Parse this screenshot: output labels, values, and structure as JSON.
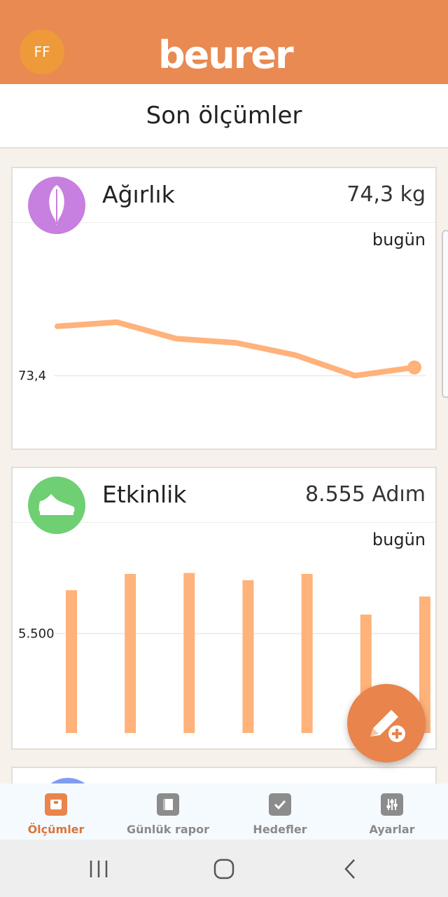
{
  "header": {
    "avatar_initials": "FF",
    "brand": "beurer",
    "brand_color": "#e88a52"
  },
  "page_title": "Son ölçümler",
  "weight_card": {
    "title": "Ağırlık",
    "value": "74,3 kg",
    "period": "bugün",
    "icon": "feather-icon",
    "icon_color": "#c77fe0",
    "chart_data": {
      "type": "line",
      "x": [
        1,
        2,
        3,
        4,
        5,
        6,
        7
      ],
      "values": [
        74.0,
        74.05,
        73.85,
        73.8,
        73.65,
        73.4,
        73.5
      ],
      "reference_value": 73.4,
      "reference_label": "73,4",
      "ylim": [
        72.6,
        74.9
      ],
      "color": "#ffb27a"
    }
  },
  "activity_card": {
    "title": "Etkinlik",
    "value": "8.555 Adım",
    "period": "bugün",
    "icon": "shoe-icon",
    "icon_color": "#6fcf73",
    "chart_data": {
      "type": "bar",
      "categories": [
        1,
        2,
        3,
        4,
        5,
        6,
        7
      ],
      "values": [
        7900,
        8800,
        8850,
        8450,
        8800,
        6550,
        7550
      ],
      "reference_value": 5500,
      "reference_label": "5.500",
      "ylim": [
        0,
        10000
      ],
      "color": "#ffb27a"
    }
  },
  "fab": {
    "icon": "edit-add-icon",
    "color": "#e8844c"
  },
  "tabs": [
    {
      "label": "Ölçümler",
      "icon": "measurements-icon",
      "active": true
    },
    {
      "label": "Günlük rapor",
      "icon": "diary-book-icon",
      "active": false
    },
    {
      "label": "Hedefler",
      "icon": "goals-check-icon",
      "active": false
    },
    {
      "label": "Ayarlar",
      "icon": "settings-sliders-icon",
      "active": false
    }
  ],
  "system_nav": {
    "recent": "recent-apps-icon",
    "home": "home-icon",
    "back": "back-icon"
  }
}
